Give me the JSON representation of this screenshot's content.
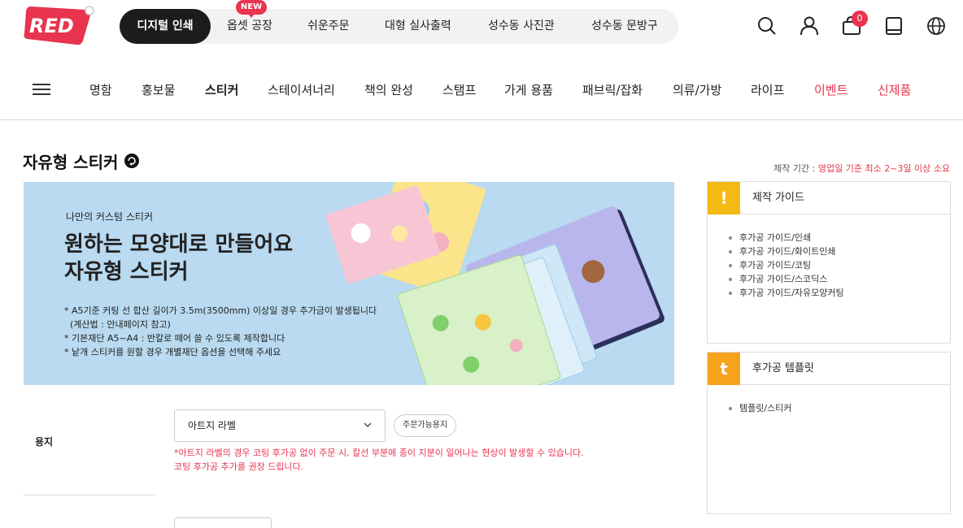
{
  "brand": {
    "logo_text": "RED"
  },
  "topnav": {
    "items": [
      "디지털 인쇄",
      "옵셋 공장",
      "쉬운주문",
      "대형 실사출력",
      "성수동 사진관",
      "성수동 문방구"
    ],
    "new_badge": "NEW"
  },
  "header_icons": {
    "search": "search-icon",
    "user": "user-icon",
    "cart": "cart-icon",
    "cart_count": "0",
    "book": "book-icon",
    "language": "globe-icon"
  },
  "categories": [
    "명함",
    "홍보물",
    "스티커",
    "스테이셔너리",
    "책의 완성",
    "스탬프",
    "가게 용품",
    "패브릭/잡화",
    "의류/가방",
    "라이프",
    "이벤트",
    "신제품"
  ],
  "page": {
    "title": "자유형 스티커",
    "production_label": "제작 기간 : ",
    "production_value": "영업일 기준 최소 2~3일 이상 소요"
  },
  "banner": {
    "small": "나만의 커스텀 스티커",
    "headline_1": "원하는 모양대로 만들어요",
    "headline_2": "자유형 스티커",
    "notes": [
      "* A5기준 커팅 선 합산 길이가 3.5m(3500mm) 이상일 경우 추가금이 발생됩니다",
      "  (계산법 : 안내페이지 참고)",
      "* 기본재단 A5~A4 : 반칼로 떼어 쓸 수 있도록 제작합니다",
      "* 낱개 스티커를 원할 경우 개별재단 옵션을 선택해 주세요"
    ]
  },
  "options": {
    "paper_label": "용지",
    "paper_value": "아트지 라벨",
    "paper_pill": "주문가능용지",
    "warning_1": "*아트지 라벨의 경우 코팅 후가공 없이 주문 시, 칼선 부분에 종이 지분이 일어나는 현상이 발생할 수 있습니다.",
    "warning_2": "코팅 후가공 추가를 권장 드립니다."
  },
  "guide_panel": {
    "badge": "!",
    "title": "제작 가이드",
    "items": [
      "후가공 가이드/인쇄",
      "후가공 가이드/화이트인쇄",
      "후가공 가이드/코팅",
      "후가공 가이드/스코딕스",
      "후가공 가이드/자유모양커팅"
    ]
  },
  "template_panel": {
    "badge": "t",
    "title": "후가공 템플릿",
    "items": [
      "템플릿/스티커"
    ]
  },
  "colors": {
    "accent": "#e8344e",
    "badge": "#f5b914",
    "banner": "#b9daf0",
    "nav_active": "#1c1c1c"
  }
}
